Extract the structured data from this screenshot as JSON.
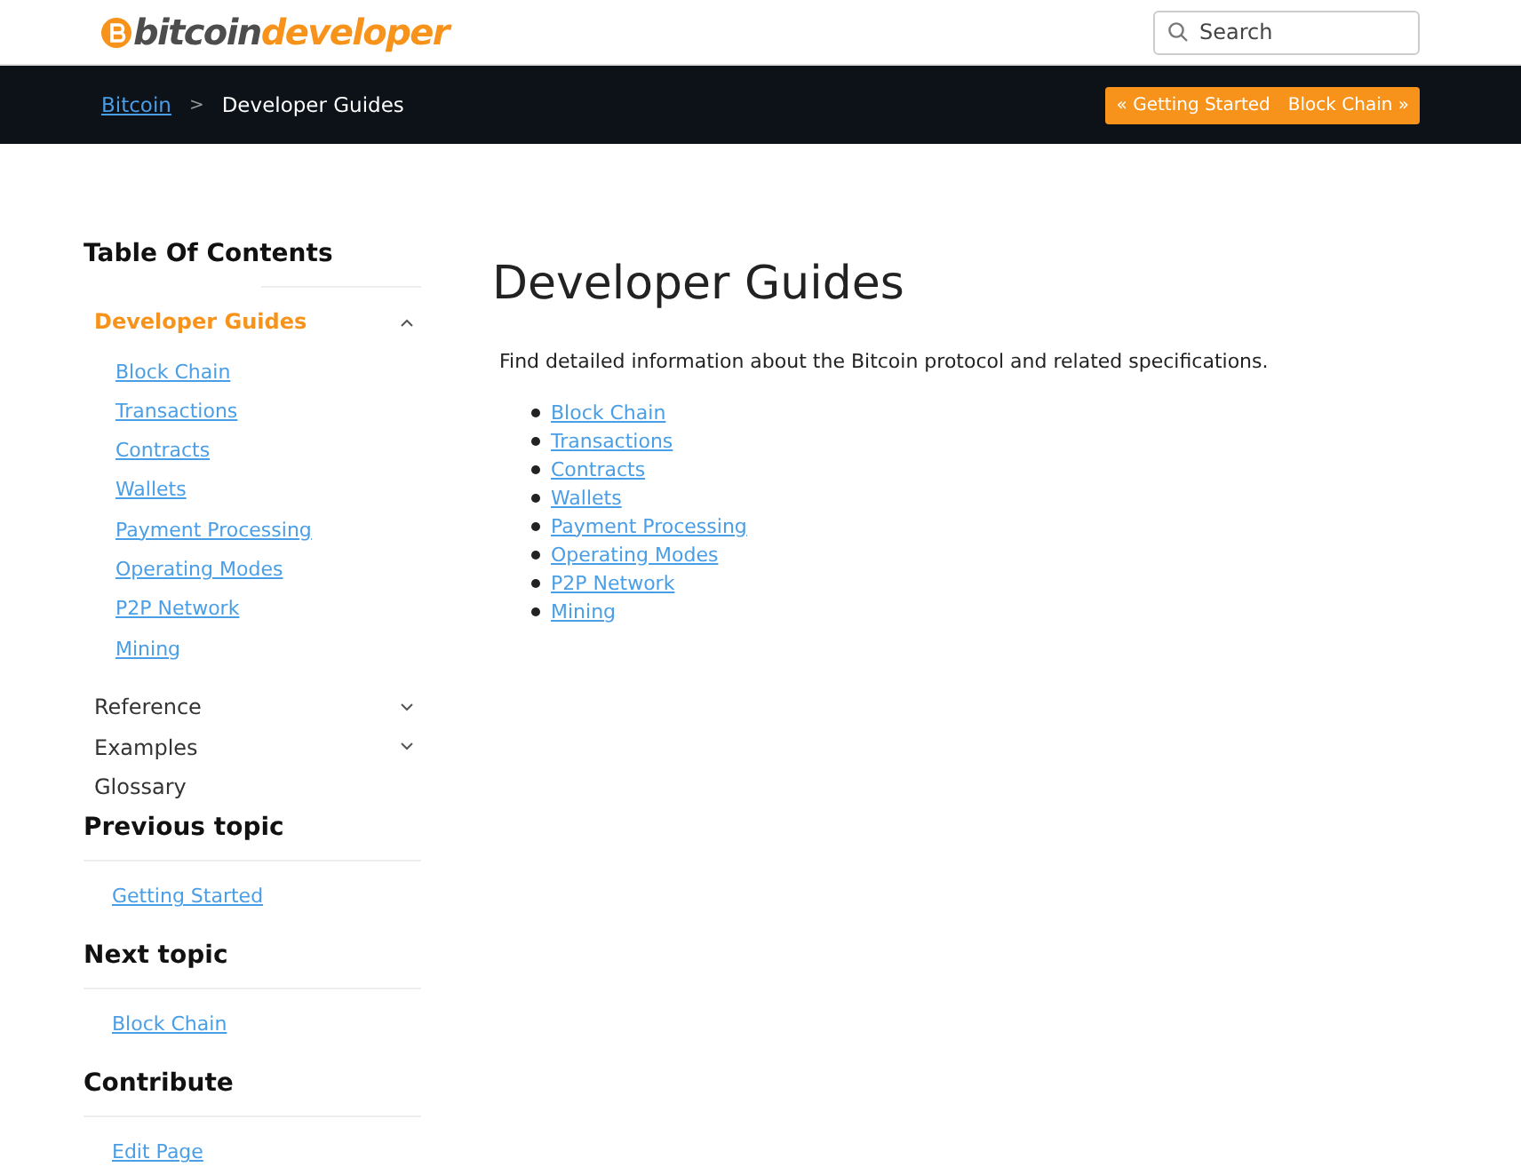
{
  "logo": {
    "part1": "bitcoin",
    "part2": "developer"
  },
  "search": {
    "placeholder": "Search"
  },
  "breadcrumb": [
    {
      "label": "Bitcoin",
      "link": true
    },
    {
      "label": "Developer Guides",
      "link": false
    }
  ],
  "breadcrumb_separator": ">",
  "pager": [
    "« Getting Started",
    "Block Chain »"
  ],
  "toc": {
    "title": "Table Of Contents",
    "sections": [
      {
        "label": "Developer Guides",
        "kind": "group",
        "selected": true,
        "expanded": true,
        "children": [
          "Block Chain",
          "Transactions",
          "Contracts",
          "Wallets",
          "Payment Processing",
          "Operating Modes",
          "P2P Network",
          "Mining"
        ]
      },
      {
        "label": "Reference",
        "kind": "group",
        "selected": false,
        "expanded": false
      },
      {
        "label": "Examples",
        "kind": "group",
        "selected": false,
        "expanded": false
      },
      {
        "label": "Glossary",
        "kind": "link",
        "selected": false
      }
    ]
  },
  "side_blocks": [
    {
      "title": "Previous topic",
      "link": "Getting Started"
    },
    {
      "title": "Next topic",
      "link": "Block Chain"
    },
    {
      "title": "Contribute",
      "link": "Edit Page"
    }
  ],
  "page": {
    "title": "Developer Guides",
    "intro": "Find detailed information about the Bitcoin protocol and related specifications.",
    "links": [
      "Block Chain",
      "Transactions",
      "Contracts",
      "Wallets",
      "Payment Processing",
      "Operating Modes",
      "P2P Network",
      "Mining"
    ]
  }
}
